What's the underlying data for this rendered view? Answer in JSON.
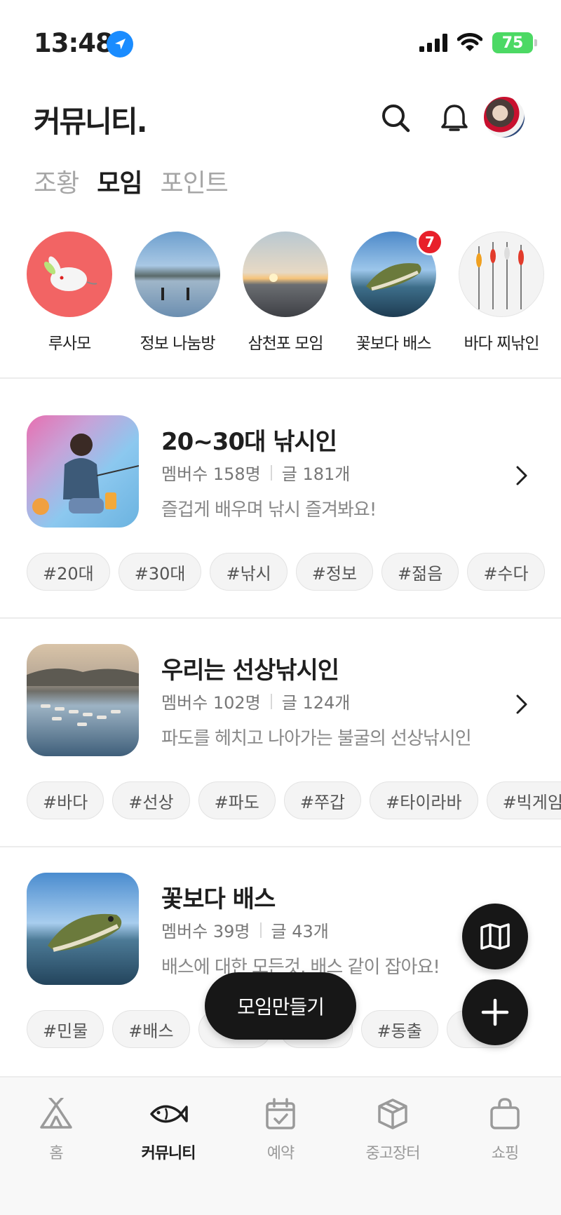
{
  "status_bar": {
    "time": "13:48",
    "battery": "75"
  },
  "header": {
    "title": "커뮤니티",
    "title_dot": "."
  },
  "tabs": [
    {
      "label": "조황",
      "active": false
    },
    {
      "label": "모임",
      "active": true
    },
    {
      "label": "포인트",
      "active": false
    }
  ],
  "stories": [
    {
      "label": "루사모"
    },
    {
      "label": "정보 나눔방"
    },
    {
      "label": "삼천포 모임"
    },
    {
      "label": "꽃보다 배스",
      "badge": "7"
    },
    {
      "label": "바다 찌낚인"
    }
  ],
  "groups": [
    {
      "name": "20~30대 낚시인",
      "members": "멤버수 158명",
      "posts": "글 181개",
      "description": "즐겁게 배우며 낚시 즐겨봐요!",
      "tags": [
        "#20대",
        "#30대",
        "#낚시",
        "#정보",
        "#젊음",
        "#수다"
      ]
    },
    {
      "name": "우리는 선상낚시인",
      "members": "멤버수 102명",
      "posts": "글 124개",
      "description": "파도를 헤치고 나아가는 불굴의 선상낚시인",
      "tags": [
        "#바다",
        "#선상",
        "#파도",
        "#쭈갑",
        "#타이라바",
        "#빅게임"
      ]
    },
    {
      "name": "꽃보다 배스",
      "members": "멤버수 39명",
      "posts": "글 43개",
      "description": "배스에 대한 모든것, 배스 같이 잡아요!",
      "tags": [
        "#민물",
        "#배스",
        "",
        "",
        "#동출",
        ""
      ]
    }
  ],
  "floating": {
    "create_label": "모임만들기"
  },
  "bottom_nav": [
    {
      "label": "홈",
      "icon": "tent-icon",
      "active": false
    },
    {
      "label": "커뮤니티",
      "icon": "fish-icon",
      "active": true
    },
    {
      "label": "예약",
      "icon": "calendar-check-icon",
      "active": false
    },
    {
      "label": "중고장터",
      "icon": "box-icon",
      "active": false
    },
    {
      "label": "쇼핑",
      "icon": "shopping-bag-icon",
      "active": false
    }
  ],
  "colors": {
    "accent_dark": "#171717",
    "badge_red": "#e8202a",
    "battery_green": "#4cd964",
    "location_blue": "#1a8cff"
  }
}
